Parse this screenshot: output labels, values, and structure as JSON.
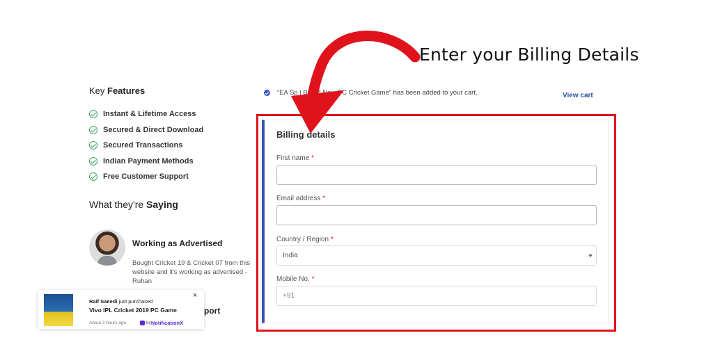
{
  "annotation": {
    "title": "Enter your Billing Details"
  },
  "sidebar": {
    "key_title_prefix": "Key ",
    "key_title_bold": "Features",
    "features": [
      "Instant & Lifetime Access",
      "Secured & Direct Download",
      "Secured Transactions",
      "Indian Payment Methods",
      "Free Customer Support"
    ],
    "saying_prefix": "What they're ",
    "saying_bold": "Saying",
    "review": {
      "title": "Working as Advertised",
      "text": "Bought Cricket 19 & Cricket 07 from this website and it's working as advertised - Ruhan"
    },
    "next_review_partial": "port"
  },
  "notification": {
    "buyer": "Raif Saeedi",
    "action": " just purchased",
    "product": "Vivo IPL Cricket 2019 PC Game",
    "time": "About 3 hours ago",
    "brand_prefix": "by ",
    "brand_name": "NotificationX",
    "close": "×"
  },
  "cart_notice": {
    "text": "“EA Sp                    | Brand New PC Cricket Game” has been added to your cart.",
    "view_cart": "View cart"
  },
  "billing": {
    "title": "Billing details",
    "first_name": {
      "label": "First name",
      "required": "*",
      "value": ""
    },
    "email": {
      "label": "Email address",
      "required": "*",
      "value": ""
    },
    "country": {
      "label": "Country / Region",
      "required": "*",
      "value": "India"
    },
    "mobile": {
      "label": "Mobile No.",
      "required": "*",
      "placeholder": "+91"
    }
  },
  "colors": {
    "highlight": "#e0131d",
    "accent": "#3b4fb8",
    "check": "#3aa757",
    "link": "#2a4ea3"
  }
}
